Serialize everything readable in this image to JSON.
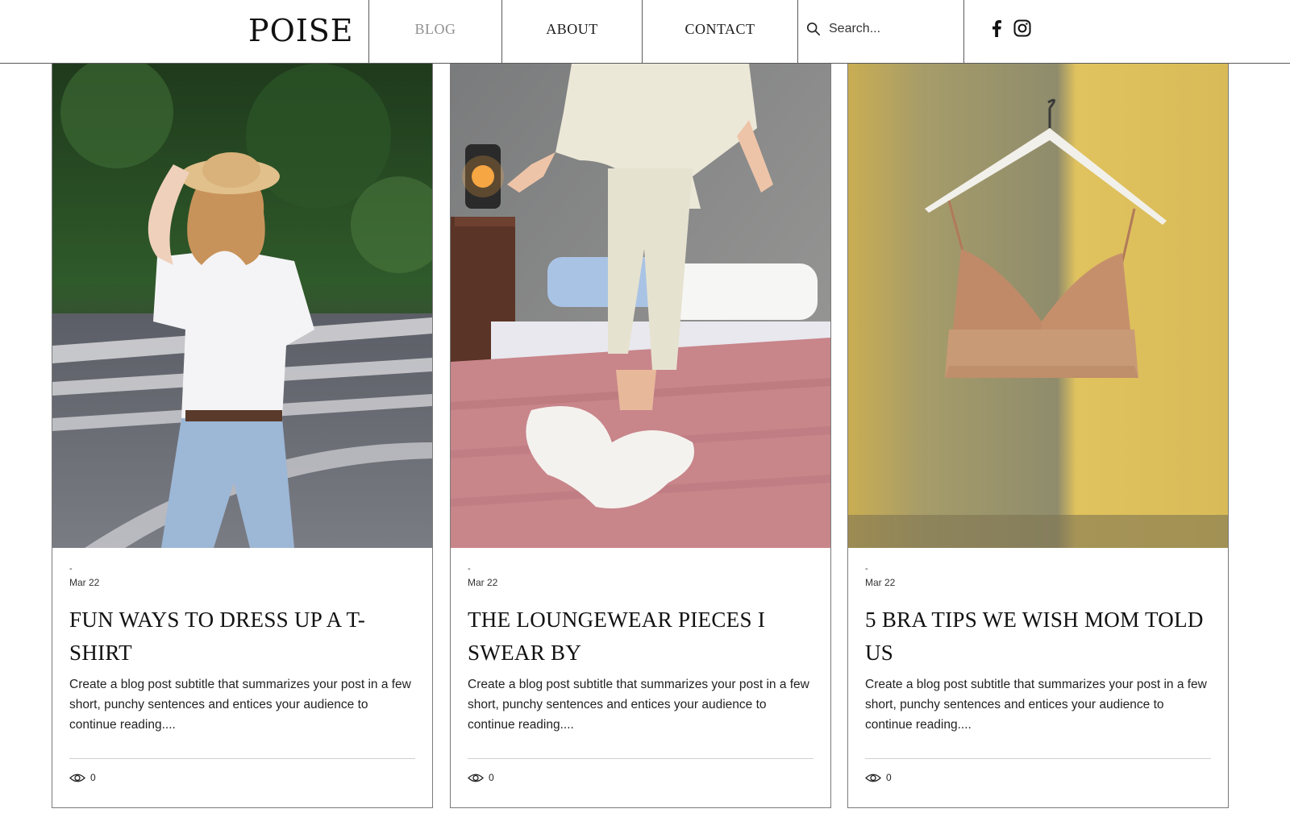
{
  "site": {
    "logo": "POISE"
  },
  "nav": {
    "items": [
      {
        "label": "BLOG",
        "active": true
      },
      {
        "label": "ABOUT",
        "active": false
      },
      {
        "label": "CONTACT",
        "active": false
      }
    ]
  },
  "search": {
    "placeholder": "Search..."
  },
  "social": {
    "icons": [
      "facebook-icon",
      "instagram-icon"
    ]
  },
  "colors": {
    "active_nav": "#8f8f8f",
    "border": "#5a5a5a",
    "text": "#111111"
  },
  "posts": [
    {
      "dash": "-",
      "date": "Mar 22",
      "title": "FUN WAYS TO DRESS UP A T-SHIRT",
      "subtitle": "Create a blog post subtitle that summarizes your post in a few short, punchy sentences and entices your audience to continue reading....",
      "views": "0"
    },
    {
      "dash": "-",
      "date": "Mar 22",
      "title": "THE LOUNGEWEAR PIECES I SWEAR BY",
      "subtitle": "Create a blog post subtitle that summarizes your post in a few short, punchy sentences and entices your audience to continue reading....",
      "views": "0"
    },
    {
      "dash": "-",
      "date": "Mar 22",
      "title": "5 BRA TIPS WE WISH MOM TOLD US",
      "subtitle": "Create a blog post subtitle that summarizes your post in a few short, punchy sentences and entices your audience to continue reading....",
      "views": "0"
    }
  ]
}
